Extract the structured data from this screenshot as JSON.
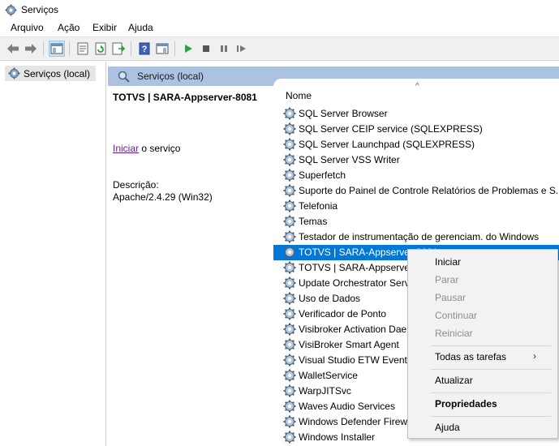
{
  "window": {
    "title": "Serviços",
    "icon": "gear-icon"
  },
  "menubar": [
    "Arquivo",
    "Ação",
    "Exibir",
    "Ajuda"
  ],
  "toolbar": {
    "buttons": [
      "back-icon",
      "forward-icon",
      "show-hide-console-tree-icon",
      "properties-icon",
      "refresh-icon",
      "export-list-icon",
      "help-icon",
      "show-hide-action-pane-icon",
      "start-icon",
      "stop-icon",
      "pause-icon",
      "resume-icon"
    ]
  },
  "tree": {
    "root_label": "Serviços (local)"
  },
  "panel": {
    "header_title": "Serviços (local)",
    "service_title": "TOTVS | SARA-Appserver-8081",
    "start_link": "Iniciar",
    "start_suffix": " o serviço",
    "description_label": "Descrição:",
    "description_text": "Apache/2.4.29 (Win32)"
  },
  "list": {
    "column_name": "Nome",
    "sort_indicator": "^",
    "selected_index": 9,
    "rows": [
      "SQL Server Browser",
      "SQL Server CEIP service (SQLEXPRESS)",
      "SQL Server Launchpad (SQLEXPRESS)",
      "SQL Server VSS Writer",
      "Superfetch",
      "Suporte do Painel de Controle Relatórios de Problemas e S...",
      "Telefonia",
      "Temas",
      "Testador de instrumentação de gerenciam. do Windows",
      "TOTVS | SARA-Appserver-8081",
      "TOTVS | SARA-Appserver-",
      "Update Orchestrator Servi",
      "Uso de Dados",
      "Verificador de Ponto",
      "Visibroker Activation Dae",
      "VisiBroker Smart Agent",
      "Visual Studio ETW Event C",
      "WalletService",
      "WarpJITSvc",
      "Waves Audio Services",
      "Windows Defender Firewa",
      "Windows Installer"
    ]
  },
  "context_menu": {
    "items": [
      {
        "label": "Iniciar",
        "enabled": true
      },
      {
        "label": "Parar",
        "enabled": false
      },
      {
        "label": "Pausar",
        "enabled": false
      },
      {
        "label": "Continuar",
        "enabled": false
      },
      {
        "label": "Reiniciar",
        "enabled": false
      },
      {
        "label": "Todas as tarefas",
        "enabled": true,
        "submenu": true
      },
      {
        "label": "Atualizar",
        "enabled": true
      },
      {
        "label": "Propriedades",
        "enabled": true,
        "bold": true
      },
      {
        "label": "Ajuda",
        "enabled": true
      }
    ]
  },
  "colors": {
    "selection": "#0078d7",
    "panel_header": "#acc2e1",
    "link": "#6a1a9a"
  }
}
